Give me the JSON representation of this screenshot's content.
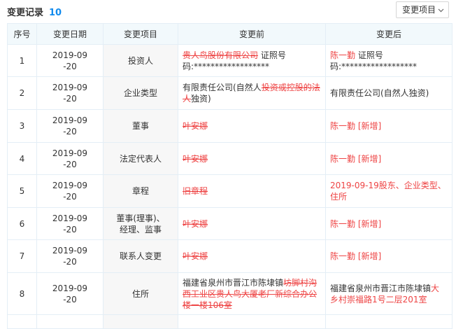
{
  "header": {
    "title": "变更记录",
    "count": "10",
    "filter_label": "变更项目"
  },
  "columns": [
    "序号",
    "变更日期",
    "变更项目",
    "变更前",
    "变更后"
  ],
  "rows": [
    {
      "no": "1",
      "date": "2019-09-20",
      "item": "投资人",
      "before": [
        {
          "t": "贵人鸟股份有限公司",
          "s": "del"
        },
        {
          "t": " 证照号码:******************",
          "s": "normal"
        }
      ],
      "after": [
        {
          "t": "陈一勤",
          "s": "add"
        },
        {
          "t": " 证照号码:******************",
          "s": "normal"
        }
      ]
    },
    {
      "no": "2",
      "date": "2019-09-20",
      "item": "企业类型",
      "before": [
        {
          "t": "有限责任公司(自然人",
          "s": "normal"
        },
        {
          "t": "投资或控股的法人",
          "s": "del"
        },
        {
          "t": "独资)",
          "s": "normal"
        }
      ],
      "after": [
        {
          "t": "有限责任公司(自然人独资)",
          "s": "normal"
        }
      ]
    },
    {
      "no": "3",
      "date": "2019-09-20",
      "item": "董事",
      "before": [
        {
          "t": "叶安娜",
          "s": "del"
        }
      ],
      "after": [
        {
          "t": "陈一勤 [新增]",
          "s": "add"
        }
      ]
    },
    {
      "no": "4",
      "date": "2019-09-20",
      "item": "法定代表人",
      "before": [
        {
          "t": "叶安娜",
          "s": "del"
        }
      ],
      "after": [
        {
          "t": "陈一勤 [新增]",
          "s": "add"
        }
      ]
    },
    {
      "no": "5",
      "date": "2019-09-20",
      "item": "章程",
      "before": [
        {
          "t": "旧章程",
          "s": "del"
        }
      ],
      "after": [
        {
          "t": "2019-09-19股东、企业类型、住所",
          "s": "add"
        }
      ]
    },
    {
      "no": "6",
      "date": "2019-09-20",
      "item": "董事(理事)、经理、监事",
      "before": [
        {
          "t": "叶安娜",
          "s": "del"
        }
      ],
      "after": [
        {
          "t": "陈一勤 [新增]",
          "s": "add"
        }
      ]
    },
    {
      "no": "7",
      "date": "2019-09-20",
      "item": "联系人变更",
      "before": [
        {
          "t": "叶安娜",
          "s": "del"
        }
      ],
      "after": [
        {
          "t": "陈一勤 [新增]",
          "s": "add"
        }
      ]
    },
    {
      "no": "8",
      "date": "2019-09-20",
      "item": "住所",
      "before": [
        {
          "t": "福建省泉州市晋江市陈埭镇",
          "s": "normal"
        },
        {
          "t": "坊脚村沟西工业区贵人鸟大厦老厂新综合办公楼一楼106室",
          "s": "del"
        }
      ],
      "after": [
        {
          "t": "福建省泉州市晋江市陈埭镇",
          "s": "normal"
        },
        {
          "t": "大乡村崇福路1号二层201室",
          "s": "add"
        }
      ]
    },
    {
      "no": "",
      "date": "",
      "item": "",
      "before": [],
      "after": []
    }
  ],
  "colors": {
    "accent": "#128bed",
    "changed": "#ee4444",
    "header_bg": "#f2f9fc",
    "border": "#e4eef6",
    "label_bg": "#f7f7f7"
  }
}
